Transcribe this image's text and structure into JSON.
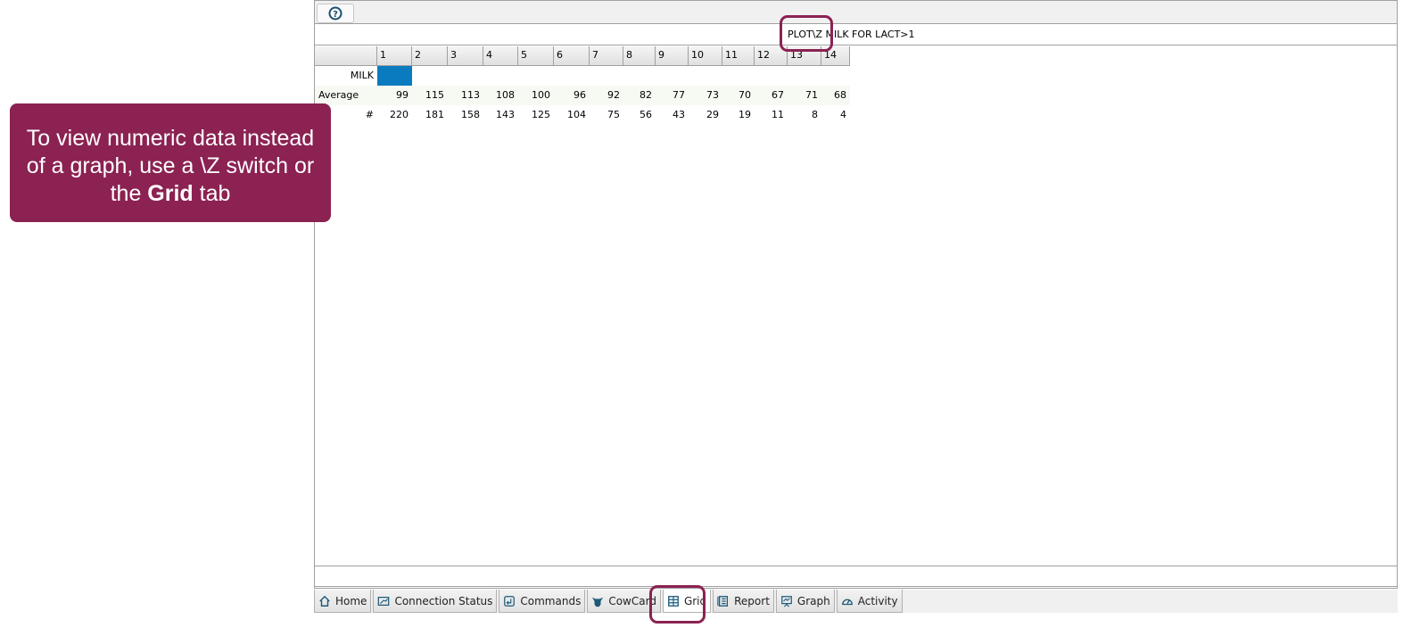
{
  "command": "PLOT\\Z MILK FOR LACT>1",
  "grid": {
    "columns": [
      "1",
      "2",
      "3",
      "4",
      "5",
      "6",
      "7",
      "8",
      "9",
      "10",
      "11",
      "12",
      "13",
      "14"
    ],
    "series_label": "MILK",
    "series_color": "#0a7bbf",
    "rows": [
      {
        "label": "Average",
        "values": [
          "99",
          "115",
          "113",
          "108",
          "100",
          "96",
          "92",
          "82",
          "77",
          "73",
          "70",
          "67",
          "71",
          "68"
        ]
      },
      {
        "label": "#",
        "values": [
          "220",
          "181",
          "158",
          "143",
          "125",
          "104",
          "75",
          "56",
          "43",
          "29",
          "19",
          "11",
          "8",
          "4"
        ]
      }
    ]
  },
  "tabs": [
    {
      "label": "Home",
      "icon": "home-icon"
    },
    {
      "label": "Connection Status",
      "icon": "connection-icon"
    },
    {
      "label": "Commands",
      "icon": "commands-icon"
    },
    {
      "label": "CowCard",
      "icon": "cow-icon"
    },
    {
      "label": "Grid",
      "icon": "grid-icon",
      "active": true
    },
    {
      "label": "Report",
      "icon": "report-icon"
    },
    {
      "label": "Graph",
      "icon": "graph-icon"
    },
    {
      "label": "Activity",
      "icon": "activity-icon"
    }
  ],
  "callout": {
    "line1": "To view numeric data instead",
    "line2": "of a graph, use a \\Z switch or",
    "line3_pre": "the ",
    "line3_bold": "Grid",
    "line3_post": " tab"
  },
  "accent": "#8b2252"
}
